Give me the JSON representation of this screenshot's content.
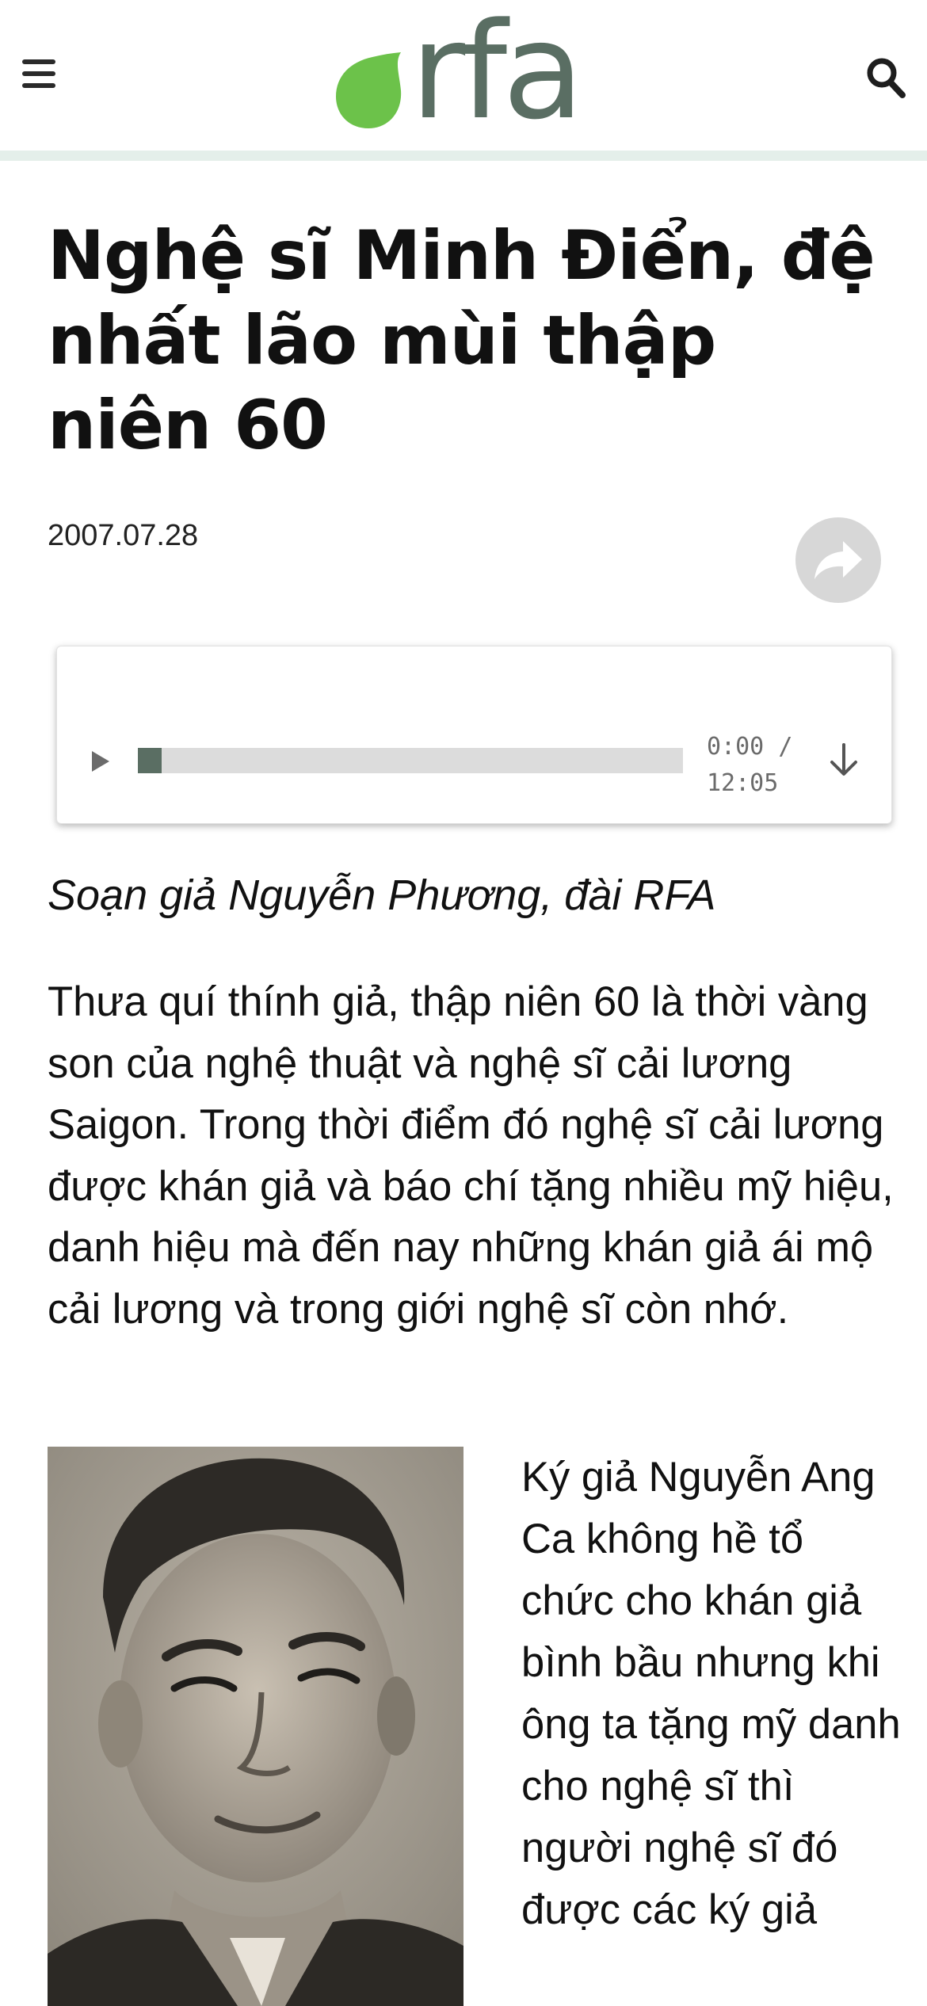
{
  "header": {
    "logo_text": "rfa",
    "brand_colors": {
      "dot": "#6cc24a",
      "text": "#5a6e63",
      "rule": "#e4efea"
    },
    "menu_icon": "hamburger-menu-icon",
    "search_icon": "search-icon"
  },
  "article": {
    "title": "Nghệ sĩ Minh Điển, đệ nhất lão mùi thập niên 60",
    "date": "2007.07.28",
    "share_icon": "share-arrow-icon",
    "byline": "Soạn giả Nguyễn Phương, đài RFA",
    "paragraph_1": "Thưa quí thính giả, thập niên 60 là thời vàng son của nghệ thuật và nghệ sĩ cải lương Saigon. Trong thời điểm đó nghệ sĩ cải lương được khán giả và báo chí tặng nhiều mỹ hiệu, danh hiệu mà đến nay những khán giả ái mộ cải lương và trong giới nghệ sĩ còn nhớ.",
    "paragraph_2": "Ký giả Nguyễn Ang Ca không hề tổ chức cho khán giả bình bầu nhưng khi ông ta tặng mỹ danh cho nghệ sĩ thì người nghệ sĩ đó được các ký giả"
  },
  "player": {
    "current_time": "0:00",
    "separator": "/",
    "duration": "12:05",
    "progress": 0.0,
    "play_icon": "play-icon",
    "download_icon": "download-arrow-icon"
  }
}
